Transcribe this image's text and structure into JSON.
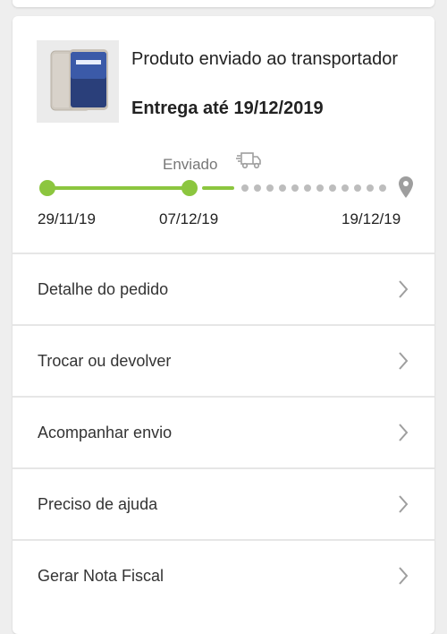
{
  "product": {
    "image_icon": "smartphone-image",
    "status_text": "Produto enviado ao transportador",
    "delivery_text": "Entrega até 19/12/2019"
  },
  "tracking": {
    "current_stage_label": "Enviado",
    "truck_icon": "delivery-truck-icon",
    "destination_icon": "location-pin-icon",
    "dates": {
      "start": "29/11/19",
      "shipped": "07/12/19",
      "delivery": "19/12/19"
    },
    "colors": {
      "done": "#8cc63f",
      "pending": "#bdbdbd"
    }
  },
  "menu": {
    "items": [
      {
        "label": "Detalhe do pedido",
        "icon": "chevron-right-icon"
      },
      {
        "label": "Trocar ou devolver",
        "icon": "chevron-right-icon"
      },
      {
        "label": "Acompanhar envio",
        "icon": "chevron-right-icon"
      },
      {
        "label": "Preciso de ajuda",
        "icon": "chevron-right-icon"
      },
      {
        "label": "Gerar Nota Fiscal",
        "icon": "chevron-right-icon"
      }
    ]
  }
}
